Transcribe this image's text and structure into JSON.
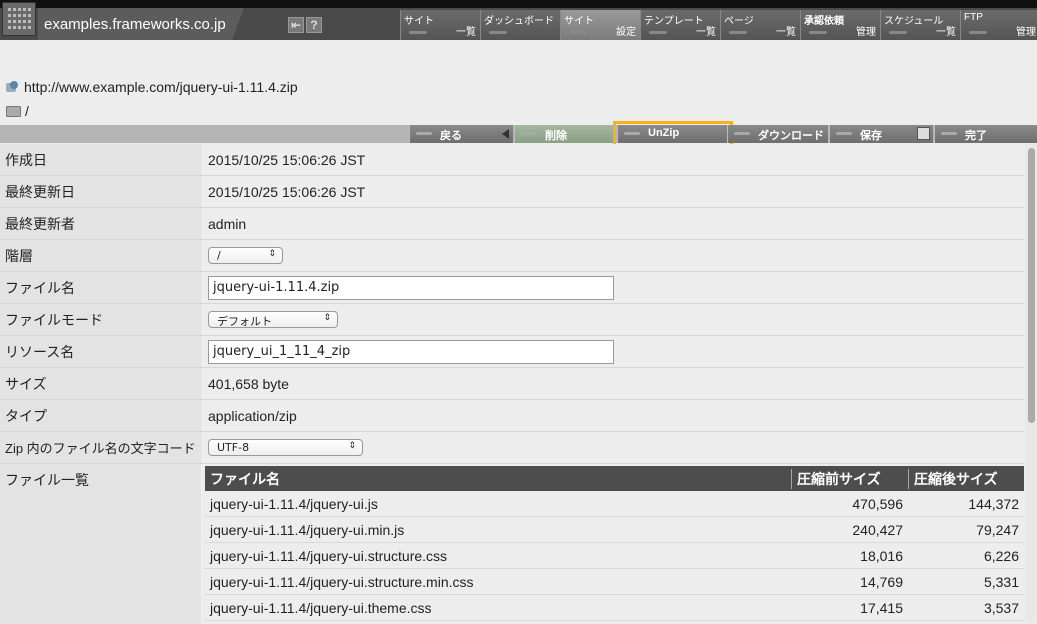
{
  "header": {
    "host": "examples.frameworks.co.jp",
    "icons": [
      "back-arrow-icon",
      "help-icon"
    ],
    "help_glyph": "?",
    "menu": [
      {
        "top": "サイト",
        "bottom": "一覧"
      },
      {
        "top": "ダッシュボード",
        "bottom": ""
      },
      {
        "top": "サイト",
        "bottom": "設定"
      },
      {
        "top": "テンプレート",
        "bottom": "一覧"
      },
      {
        "top": "ページ",
        "bottom": "一覧"
      },
      {
        "top": "承認依頼",
        "bottom": "管理"
      },
      {
        "top": "スケジュール",
        "bottom": "一覧"
      },
      {
        "top": "FTP",
        "bottom": "管理"
      }
    ]
  },
  "path": {
    "url": "http://www.example.com/jquery-ui-1.11.4.zip",
    "folder": "/"
  },
  "actions": {
    "back": "戻る",
    "delete": "削除",
    "unzip": "UnZip",
    "download": "ダウンロード",
    "save": "保存",
    "done": "完了"
  },
  "form": {
    "created_label": "作成日",
    "created_value": "2015/10/25 15:06:26 JST",
    "modified_label": "最終更新日",
    "modified_value": "2015/10/25 15:06:26 JST",
    "modifier_label": "最終更新者",
    "modifier_value": "admin",
    "level_label": "階層",
    "level_value": "/",
    "filename_label": "ファイル名",
    "filename_value": "jquery-ui-1.11.4.zip",
    "filemode_label": "ファイルモード",
    "filemode_value": "デフォルト",
    "resource_label": "リソース名",
    "resource_value": "jquery_ui_1_11_4_zip",
    "size_label": "サイズ",
    "size_value": "401,658 byte",
    "type_label": "タイプ",
    "type_value": "application/zip",
    "charset_label": "Zip 内のファイル名の文字コード",
    "charset_value": "UTF-8",
    "filelist_label": "ファイル一覧"
  },
  "filelist": {
    "headers": [
      "ファイル名",
      "圧縮前サイズ",
      "圧縮後サイズ"
    ],
    "rows": [
      [
        "jquery-ui-1.11.4/jquery-ui.js",
        "470,596",
        "144,372"
      ],
      [
        "jquery-ui-1.11.4/jquery-ui.min.js",
        "240,427",
        "79,247"
      ],
      [
        "jquery-ui-1.11.4/jquery-ui.structure.css",
        "18,016",
        "6,226"
      ],
      [
        "jquery-ui-1.11.4/jquery-ui.structure.min.css",
        "14,769",
        "5,331"
      ],
      [
        "jquery-ui-1.11.4/jquery-ui.theme.css",
        "17,415",
        "3,537"
      ]
    ]
  },
  "colors": {
    "highlight": "#f5b21d",
    "delete_button": "#9caf94",
    "topbar": "#4a4a4a"
  }
}
